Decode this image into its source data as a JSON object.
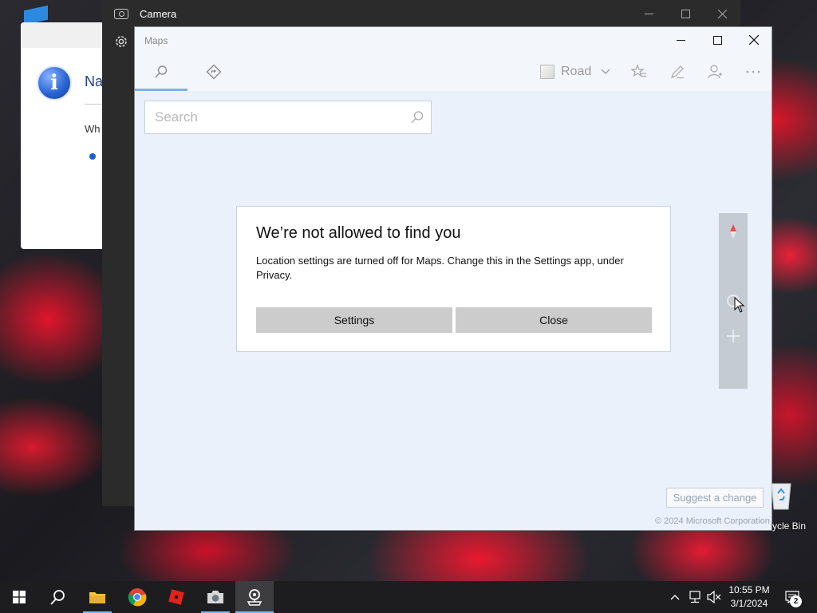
{
  "background_dialog": {
    "title_fragment": "Na",
    "text_fragment": "Wh",
    "icon": "info-icon"
  },
  "camera_window": {
    "title": "Camera",
    "controls": [
      "minimize",
      "maximize",
      "close"
    ],
    "settings_icon": "gear-icon"
  },
  "maps_window": {
    "title": "Maps",
    "tabs": [
      {
        "name": "search",
        "icon": "search-icon",
        "active": true
      },
      {
        "name": "directions",
        "icon": "directions-icon",
        "active": false
      }
    ],
    "view_selector": {
      "label": "Road"
    },
    "toolbar_icons": [
      "favorites-icon",
      "ink-icon",
      "account-icon",
      "more-icon"
    ],
    "search": {
      "placeholder": "Search",
      "value": ""
    },
    "suggest_label": "Suggest a change",
    "copyright": "© 2024 Microsoft Corporation"
  },
  "alert": {
    "title": "We’re not allowed to find you",
    "message": "Location settings are turned off for Maps. Change this in the Settings app, under Privacy.",
    "settings_button": "Settings",
    "close_button": "Close"
  },
  "desktop": {
    "recycle_bin_label": "ycle Bin"
  },
  "taskbar": {
    "apps": [
      "start",
      "search",
      "file-explorer",
      "chrome",
      "roblox",
      "camera",
      "maps"
    ],
    "time": "10:55 PM",
    "date": "3/1/2024",
    "notification_count": "2"
  },
  "colors": {
    "accent": "#79b3e8",
    "taskbar": "#1d1d1f",
    "map_background": "#eaf1fb",
    "button_gray": "#cccccc"
  }
}
